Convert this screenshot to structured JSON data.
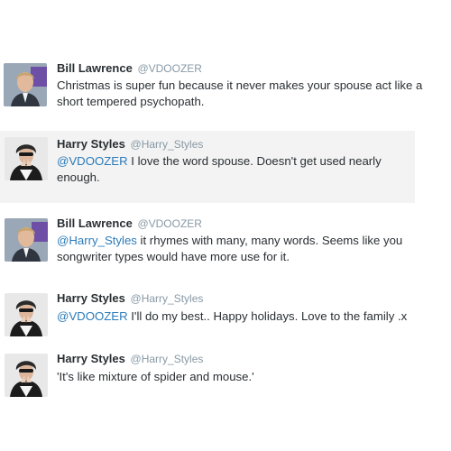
{
  "colors": {
    "link": "#2b7bb9",
    "handle": "#8899a6",
    "text": "#292f33",
    "highlight_bg": "#f3f3f3"
  },
  "tweets": [
    {
      "name": "Bill Lawrence",
      "handle": "@VDOOZER",
      "avatar_icon": "bill-lawrence-avatar-icon",
      "mention": "",
      "text": "Christmas is super fun because it never makes your spouse act like a short tempered psychopath."
    },
    {
      "name": "Harry Styles",
      "handle": "@Harry_Styles",
      "avatar_icon": "harry-styles-avatar-icon",
      "mention": "@VDOOZER",
      "text": " I love the word spouse. Doesn't get used nearly enough."
    },
    {
      "name": "Bill Lawrence",
      "handle": "@VDOOZER",
      "avatar_icon": "bill-lawrence-avatar-icon",
      "mention": "@Harry_Styles",
      "text": " it rhymes with many, many words. Seems like you songwriter types would have more use for it."
    },
    {
      "name": "Harry Styles",
      "handle": "@Harry_Styles",
      "avatar_icon": "harry-styles-avatar-icon",
      "mention": "@VDOOZER",
      "text": " I'll do my best.. Happy holidays. Love to the family .x"
    },
    {
      "name": "Harry Styles",
      "handle": "@Harry_Styles",
      "avatar_icon": "harry-styles-avatar-icon",
      "mention": "",
      "text": "'It's like mixture of spider and mouse.'"
    }
  ]
}
